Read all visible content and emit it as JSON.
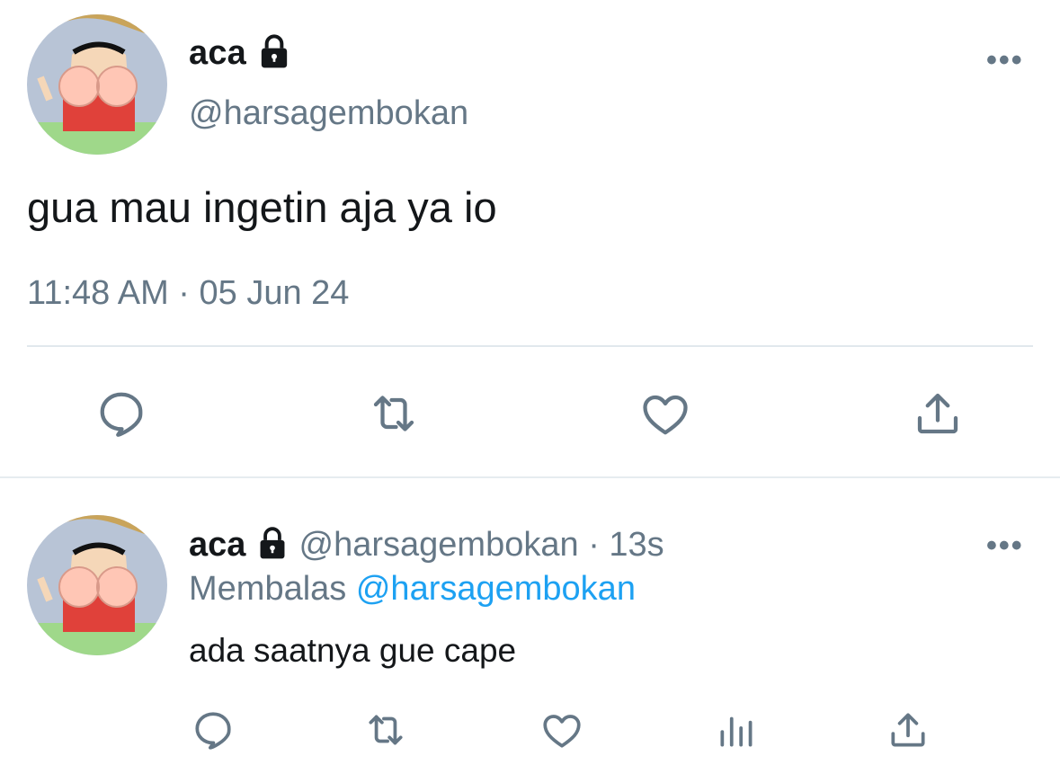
{
  "main_tweet": {
    "name": "aca",
    "handle": "@harsagembokan",
    "more": "•••",
    "text": "gua mau ingetin aja ya io",
    "timestamp": "11:48 AM · 05 Jun 24",
    "icons": {
      "lock": "lock-icon",
      "avatar": "avatar-image",
      "actions": [
        "reply-icon",
        "retweet-icon",
        "like-icon",
        "share-icon"
      ]
    }
  },
  "reply_tweet": {
    "name": "aca",
    "handle": "@harsagembokan",
    "time": "· 13s",
    "replying_prefix": "Membalas",
    "replying_to": "@harsagembokan",
    "text": "ada saatnya gue cape",
    "more": "•••",
    "icons": {
      "actions": [
        "reply-icon",
        "retweet-icon",
        "like-icon",
        "analytics-icon",
        "share-icon"
      ]
    }
  },
  "colors": {
    "text_primary": "#14171a",
    "text_secondary": "#657786",
    "link": "#1da1f2",
    "divider": "#e1e8ed"
  }
}
